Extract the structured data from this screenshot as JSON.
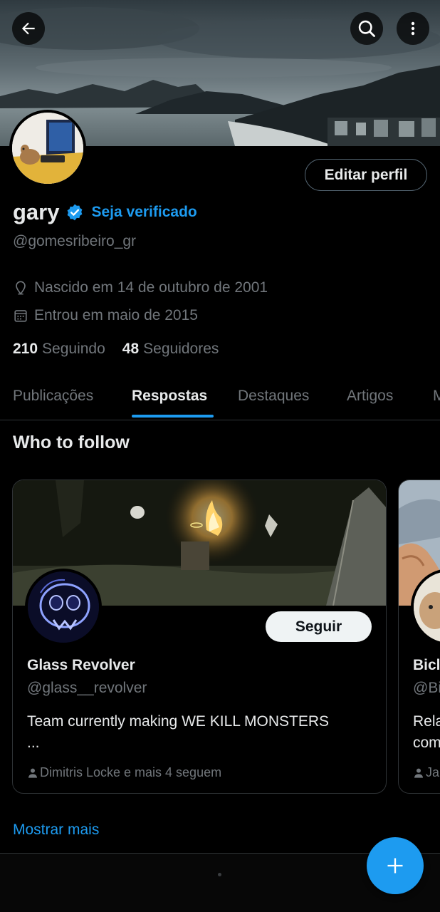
{
  "profile": {
    "display_name": "gary",
    "get_verified": "Seja verificado",
    "handle": "@gomesribeiro_gr",
    "birthday": "Nascido em 14 de outubro de 2001",
    "joined": "Entrou em maio de 2015",
    "following_count": "210",
    "following_label": "Seguindo",
    "followers_count": "48",
    "followers_label": "Seguidores",
    "edit_label": "Editar perfil"
  },
  "tabs": [
    {
      "label": "Publicações"
    },
    {
      "label": "Respostas"
    },
    {
      "label": "Destaques"
    },
    {
      "label": "Artigos"
    },
    {
      "label": "M"
    }
  ],
  "active_tab": "Respostas",
  "who_to_follow": {
    "title": "Who to follow",
    "cards": [
      {
        "name": "Glass Revolver",
        "handle": "@glass__revolver",
        "bio": "Team currently making WE KILL MONSTERS",
        "bio_more": "...",
        "social": "Dimitris Locke e mais 4 seguem",
        "follow_label": "Seguir"
      },
      {
        "name": "Bicl",
        "handle": "@Bi",
        "bio": "Rela",
        "bio_more": "com",
        "social": "Ja"
      }
    ],
    "show_more": "Mostrar mais"
  },
  "icons": {
    "back": "back-arrow-icon",
    "search": "search-icon",
    "more": "more-vertical-icon",
    "verified": "verified-badge-icon",
    "location": "location-pin-icon",
    "calendar": "calendar-icon",
    "person": "person-icon",
    "compose": "plus-icon"
  },
  "colors": {
    "accent": "#1d9bf0",
    "background": "#000000",
    "text_primary": "#e7e9ea",
    "text_secondary": "#71767b",
    "border": "#2f3336"
  }
}
